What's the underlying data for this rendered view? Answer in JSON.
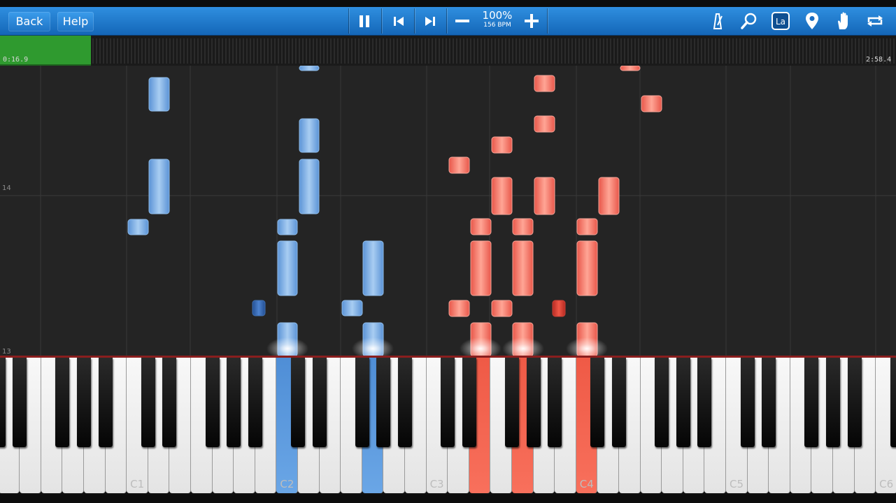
{
  "toolbar": {
    "back_label": "Back",
    "help_label": "Help",
    "speed_percent": "100%",
    "speed_bpm": "156 BPM",
    "icons": [
      "pause-icon",
      "previous-icon",
      "next-icon",
      "minus-icon",
      "plus-icon",
      "metronome-icon",
      "zoom-icon",
      "label-icon",
      "location-pin-icon",
      "hand-icon",
      "loop-icon"
    ],
    "label_icon_text": "La",
    "accent_color": "#1e78d2"
  },
  "timeline": {
    "elapsed": "0:16.9",
    "total": "2:58.4",
    "progress_fraction": 0.046,
    "progress_color": "#2f9a2f"
  },
  "piano_roll": {
    "measure_labels": [
      "14",
      "13"
    ],
    "left_hand_color": "#6ea6e2",
    "right_hand_color": "#f06a5a"
  },
  "keyboard": {
    "octave_labels": [
      "C1",
      "C2",
      "C3",
      "C4",
      "C5",
      "C6"
    ],
    "active_left_keys": [
      "C2",
      "G2"
    ],
    "active_right_keys": [
      "E3",
      "G3",
      "C4"
    ]
  }
}
